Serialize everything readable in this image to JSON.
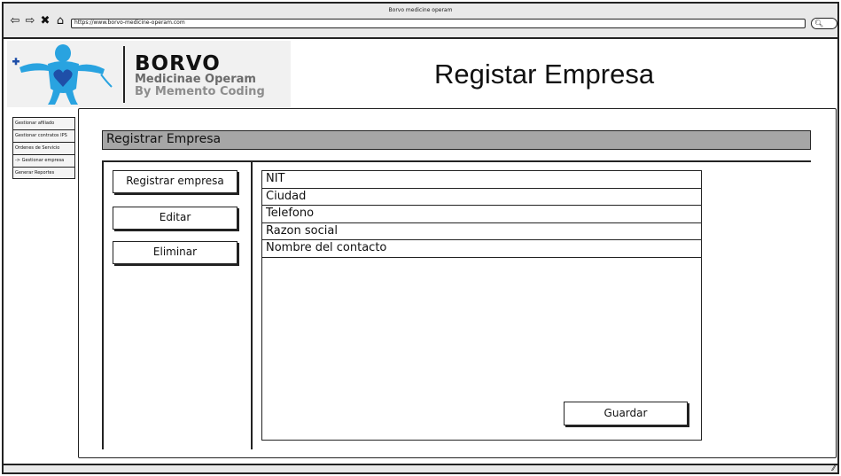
{
  "browser": {
    "window_title": "Borvo medicine operam",
    "url": "https://www.borvo-medicine-operam.com",
    "icons": [
      "back-arrow-icon",
      "forward-arrow-icon",
      "close-icon",
      "home-icon",
      "search-icon",
      "resize-grip-icon"
    ]
  },
  "header": {
    "logo": {
      "brand_name": "BORVO",
      "subtitle": "Medicinae Operam",
      "byline": "By Memento Coding"
    },
    "page_title": "Registar Empresa"
  },
  "sidebar": {
    "items": [
      {
        "label": "Gestionar afiliado"
      },
      {
        "label": "Gestionar contratos IPS"
      },
      {
        "label": "Ordenes de Servicio"
      },
      {
        "label": "-> Gestionar empresa"
      },
      {
        "label": "Generar Reportes"
      }
    ]
  },
  "main": {
    "section_title": "Registrar Empresa",
    "actions": [
      {
        "label": "Registrar empresa"
      },
      {
        "label": "Editar"
      },
      {
        "label": "Eliminar"
      }
    ],
    "form": {
      "fields": [
        {
          "label": "NIT"
        },
        {
          "label": "Ciudad"
        },
        {
          "label": "Telefono"
        },
        {
          "label": "Razon social"
        },
        {
          "label": "Nombre del contacto"
        }
      ],
      "save_label": "Guardar"
    }
  },
  "colors": {
    "section_bar": "#a6a6a6",
    "chrome": "#e9e9e9",
    "logo_blue": "#29a3e0",
    "logo_heart": "#1f4fa8"
  }
}
